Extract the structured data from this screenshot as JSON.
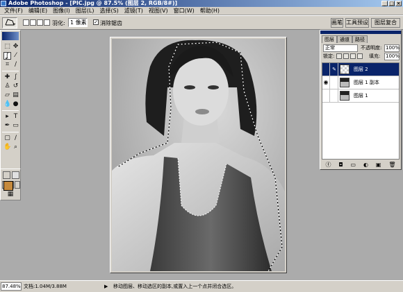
{
  "window": {
    "title": "Adobe Photoshop - [PIC.jpg @ 87.5% (图层 2, RGB/8#)]",
    "minimize": "_",
    "maximize": "□",
    "close": "×"
  },
  "menu": [
    "文件(F)",
    "编辑(E)",
    "图像(I)",
    "图层(L)",
    "选择(S)",
    "滤镜(T)",
    "视图(V)",
    "窗口(W)",
    "帮助(H)"
  ],
  "options": {
    "feather_label": "羽化:",
    "feather_value": "1 像素",
    "antialias_checked": "✓",
    "antialias_label": "消除锯齿"
  },
  "palette_well": [
    "画笔",
    "工具预设",
    "图层复合"
  ],
  "layers_panel": {
    "tabs": [
      "图层",
      "通道",
      "路径"
    ],
    "blend_mode": "正常",
    "opacity_label": "不透明度:",
    "opacity_value": "100%",
    "lock_label": "锁定:",
    "fill_label": "填充:",
    "fill_value": "100%",
    "layers": [
      {
        "name": "图层 2",
        "visible": false,
        "selected": true
      },
      {
        "name": "图层 1 副本",
        "visible": true,
        "selected": false
      },
      {
        "name": "图层 1",
        "visible": false,
        "selected": false
      }
    ]
  },
  "status": {
    "zoom": "87.48%",
    "doc_info": "文档:1.04M/3.88M",
    "hint": "移动图层、移动选区的副本,或置入上一个点并闭合选区。"
  },
  "colors": {
    "foreground": "#c68a3c",
    "background": "#ffffff",
    "titlebar": "#0a246a"
  }
}
